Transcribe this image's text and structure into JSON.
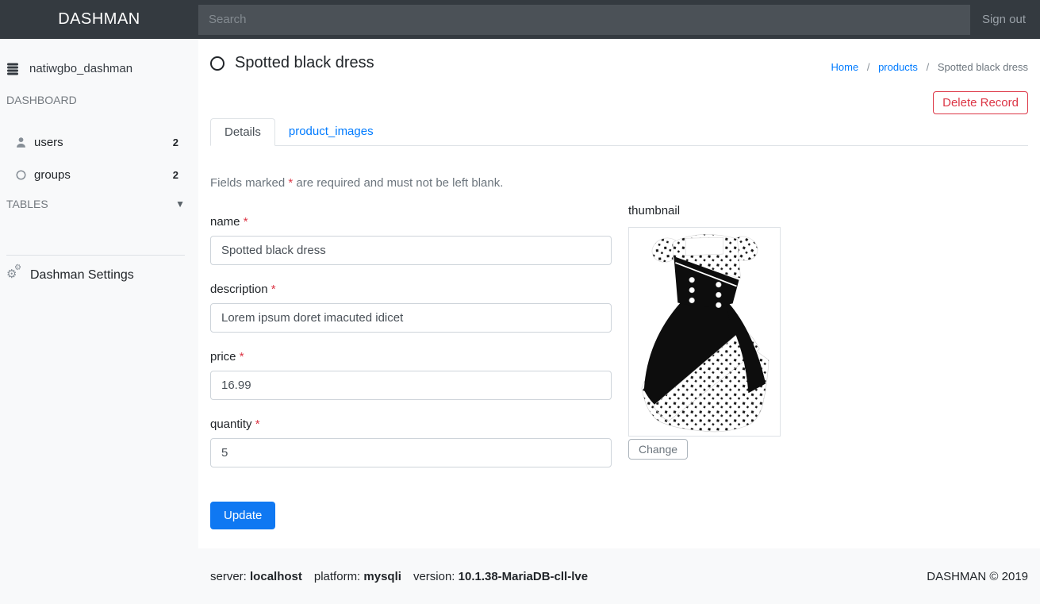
{
  "topbar": {
    "brand": "DASHMAN",
    "search_placeholder": "Search",
    "signout": "Sign out"
  },
  "sidebar": {
    "database": "natiwgbo_dashman",
    "dashboard_heading": "DASHBOARD",
    "tables_heading": "TABLES",
    "items": [
      {
        "label": "users",
        "count": "2"
      },
      {
        "label": "groups",
        "count": "2"
      }
    ],
    "settings": "Dashman Settings"
  },
  "header": {
    "title": "Spotted black dress",
    "breadcrumb": [
      "Home",
      "products",
      "Spotted black dress"
    ],
    "separator": "/",
    "delete_button": "Delete Record"
  },
  "tabs": [
    {
      "label": "Details",
      "active": true
    },
    {
      "label": "product_images",
      "active": false
    }
  ],
  "form": {
    "note_prefix": "Fields marked",
    "required_star": "*",
    "note_suffix": "are required and must not be left blank.",
    "fields": [
      {
        "label": "name",
        "value": "Spotted black dress"
      },
      {
        "label": "description",
        "value": "Lorem ipsum doret imacuted idicet"
      },
      {
        "label": "price",
        "value": "16.99"
      },
      {
        "label": "quantity",
        "value": "5"
      }
    ],
    "update_button": "Update",
    "thumbnail_label": "thumbnail",
    "change_button": "Change"
  },
  "footer": {
    "server_label": "server:",
    "server_value": "localhost",
    "platform_label": "platform:",
    "platform_value": "mysqli",
    "version_label": "version:",
    "version_value": "10.1.38-MariaDB-cll-lve",
    "copyright": "DASHMAN © 2019"
  },
  "colors": {
    "topbar_bg": "#343a40",
    "sidebar_bg": "#f8f9fa",
    "link_blue": "#007bff",
    "primary_button": "#0f78f2",
    "danger": "#dc3545",
    "border": "#dee2e6",
    "muted": "#6c757d"
  }
}
